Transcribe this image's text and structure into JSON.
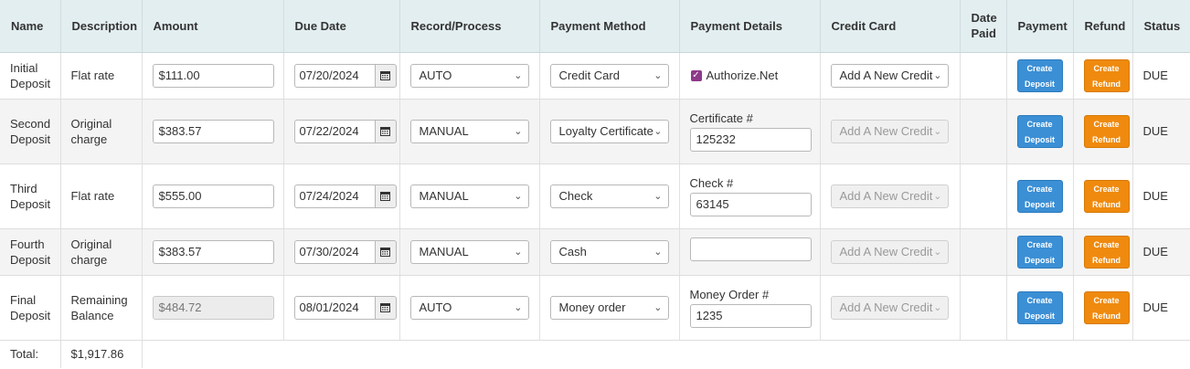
{
  "headers": {
    "name": "Name",
    "description": "Description",
    "amount": "Amount",
    "due_date": "Due Date",
    "record_process": "Record/Process",
    "payment_method": "Payment Method",
    "payment_details": "Payment Details",
    "credit_card": "Credit Card",
    "date_paid_1": "Date",
    "date_paid_2": "Paid",
    "payment": "Payment",
    "refund": "Refund",
    "status": "Status"
  },
  "rows": [
    {
      "name_1": "Initial",
      "name_2": "Deposit",
      "description": "Flat rate",
      "amount": "$111.00",
      "due_date": "07/20/2024",
      "record_process": "AUTO",
      "payment_method": "Credit Card",
      "details_checkbox_label": "Authorize.Net",
      "credit_card": "Add A New Credit",
      "date_paid": "",
      "payment_btn_1": "Create",
      "payment_btn_2": "Deposit",
      "refund_btn_1": "Create",
      "refund_btn_2": "Refund",
      "status": "DUE"
    },
    {
      "name_1": "Second",
      "name_2": "Deposit",
      "description_1": "Original",
      "description_2": "charge",
      "amount": "$383.57",
      "due_date": "07/22/2024",
      "record_process": "MANUAL",
      "payment_method": "Loyalty Certificate",
      "details_label": "Certificate #",
      "details_value": "125232",
      "credit_card": "Add A New Credit",
      "date_paid": "",
      "payment_btn_1": "Create",
      "payment_btn_2": "Deposit",
      "refund_btn_1": "Create",
      "refund_btn_2": "Refund",
      "status": "DUE"
    },
    {
      "name_1": "Third",
      "name_2": "Deposit",
      "description": "Flat rate",
      "amount": "$555.00",
      "due_date": "07/24/2024",
      "record_process": "MANUAL",
      "payment_method": "Check",
      "details_label": "Check #",
      "details_value": "63145",
      "credit_card": "Add A New Credit",
      "date_paid": "",
      "payment_btn_1": "Create",
      "payment_btn_2": "Deposit",
      "refund_btn_1": "Create",
      "refund_btn_2": "Refund",
      "status": "DUE"
    },
    {
      "name_1": "Fourth",
      "name_2": "Deposit",
      "description_1": "Original",
      "description_2": "charge",
      "amount": "$383.57",
      "due_date": "07/30/2024",
      "record_process": "MANUAL",
      "payment_method": "Cash",
      "details_value": "",
      "credit_card": "Add A New Credit",
      "date_paid": "",
      "payment_btn_1": "Create",
      "payment_btn_2": "Deposit",
      "refund_btn_1": "Create",
      "refund_btn_2": "Refund",
      "status": "DUE"
    },
    {
      "name_1": "Final",
      "name_2": "Deposit",
      "description_1": "Remaining",
      "description_2": "Balance",
      "amount": "$484.72",
      "due_date": "08/01/2024",
      "record_process": "AUTO",
      "payment_method": "Money order",
      "details_label": "Money Order #",
      "details_value": "1235",
      "credit_card": "Add A New Credit",
      "date_paid": "",
      "payment_btn_1": "Create",
      "payment_btn_2": "Deposit",
      "refund_btn_1": "Create",
      "refund_btn_2": "Refund",
      "status": "DUE"
    }
  ],
  "total": {
    "label": "Total:",
    "value": "$1,917.86"
  },
  "icons": {
    "calendar": "calendar-icon",
    "chevron": "chevron-down-icon",
    "check": "checkbox-checked-icon"
  },
  "colors": {
    "header_bg": "#e3eef0",
    "payment_btn": "#3b8fd5",
    "refund_btn": "#ef8a0e",
    "checkbox": "#8e3a8a"
  }
}
